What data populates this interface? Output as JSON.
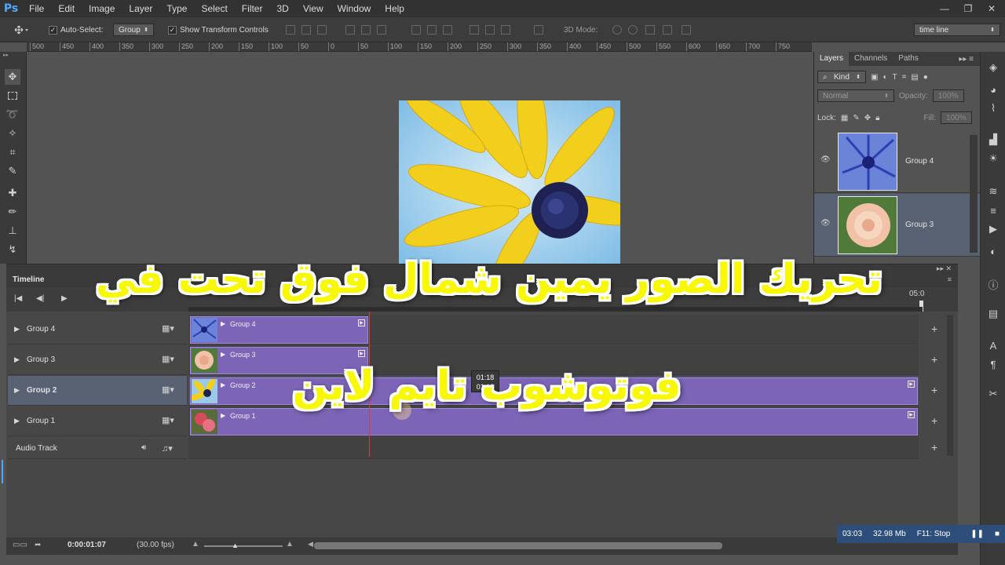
{
  "app": {
    "logo": "Ps"
  },
  "menu": [
    "File",
    "Edit",
    "Image",
    "Layer",
    "Type",
    "Select",
    "Filter",
    "3D",
    "View",
    "Window",
    "Help"
  ],
  "window_controls": [
    "—",
    "❐",
    "✕"
  ],
  "options_bar": {
    "auto_select_label": "Auto-Select:",
    "auto_select_value": "Group",
    "show_transform_label": "Show Transform Controls",
    "mode_label": "3D Mode:",
    "workspace_value": "time line"
  },
  "ruler_ticks": [
    "500",
    "450",
    "400",
    "350",
    "300",
    "250",
    "200",
    "150",
    "100",
    "50",
    "0",
    "50",
    "100",
    "150",
    "200",
    "250",
    "300",
    "350",
    "400",
    "450",
    "500",
    "550",
    "600",
    "650",
    "700",
    "750"
  ],
  "layers_panel": {
    "tabs": [
      "Layers",
      "Channels",
      "Paths"
    ],
    "kind_label": "Kind",
    "blend_mode": "Normal",
    "opacity_label": "Opacity:",
    "opacity_value": "100%",
    "lock_label": "Lock:",
    "fill_label": "Fill:",
    "fill_value": "100%",
    "layers": [
      {
        "name": "Group 4",
        "thumb": "blue-flower"
      },
      {
        "name": "Group 3",
        "thumb": "peach-rose"
      }
    ]
  },
  "timeline": {
    "title": "Timeline",
    "end_label": "05:0",
    "tracks": [
      {
        "name": "Group 4",
        "clip_label": "Group 4",
        "thumb": "blue-flower"
      },
      {
        "name": "Group 3",
        "clip_label": "Group 3",
        "thumb": "peach-rose"
      },
      {
        "name": "Group 2",
        "clip_label": "Group 2",
        "thumb": "yellow-daisy"
      },
      {
        "name": "Group 1",
        "clip_label": "Group 1",
        "thumb": "red-roses"
      }
    ],
    "audio_track": "Audio Track",
    "tooltip_time": "01:18",
    "tooltip_time2": "01:18",
    "current_time": "0:00:01:07",
    "fps": "(30.00 fps)"
  },
  "status": {
    "time": "03:03",
    "size": "32.98 Mb",
    "hint": "F11: Stop"
  },
  "overlay_text": {
    "line1": "تحريك الصور يمين شمال فوق تحت في",
    "line2": "فوتوشوب تايم لاين"
  },
  "colors": {
    "clip": "#7c64b6",
    "selection": "#586273",
    "playhead": "#e23a3a",
    "overlay": "#f8f800"
  }
}
